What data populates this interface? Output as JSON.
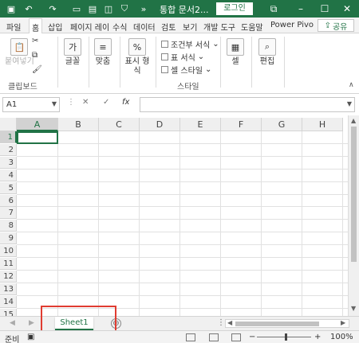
{
  "titlebar": {
    "doc_title": "통합 문서2...",
    "login_label": "로그인",
    "icons": [
      "save-icon",
      "undo-icon",
      "redo-icon",
      "new-file-icon",
      "save-file-icon",
      "camera-icon",
      "shield-icon",
      "customize-icon"
    ],
    "window_buttons": [
      "restore-icon",
      "minimize-icon",
      "maximize-icon",
      "close-icon"
    ],
    "accent_color": "#217346"
  },
  "tabs": {
    "items": [
      "파일",
      "홈",
      "삽입",
      "페이지 레이",
      "수식",
      "데이터",
      "검토",
      "보기",
      "개발 도구",
      "도움말",
      "Power Pivo"
    ],
    "active": "홈",
    "share_label": "공유"
  },
  "ribbon": {
    "paste_label": "붙여넣기",
    "clipboard_group": "클립보드",
    "font_label": "글꼴",
    "align_label": "맞춤",
    "number_label": "표시 형식",
    "styles_group": "스타일",
    "conditional_format": "조건부 서식",
    "table_format": "표 서식",
    "cell_styles": "셀 스타일",
    "cells_label": "셀",
    "edit_label": "편집"
  },
  "formula_bar": {
    "name_box": "A1",
    "cancel_symbol": "✕",
    "enter_symbol": "✓",
    "fx_symbol": "fx",
    "formula_value": ""
  },
  "grid": {
    "columns": [
      "A",
      "B",
      "C",
      "D",
      "E",
      "F",
      "G",
      "H"
    ],
    "rows": [
      "1",
      "2",
      "3",
      "4",
      "5",
      "6",
      "7",
      "8",
      "9",
      "10",
      "11",
      "12",
      "13",
      "14",
      "15"
    ],
    "selected_cell": "A1"
  },
  "sheets": {
    "tabs": [
      "Sheet1"
    ],
    "active": "Sheet1",
    "add_symbol": "⊕"
  },
  "status": {
    "ready": "준비",
    "zoom_minus": "−",
    "zoom_plus": "+",
    "zoom": "100%"
  }
}
